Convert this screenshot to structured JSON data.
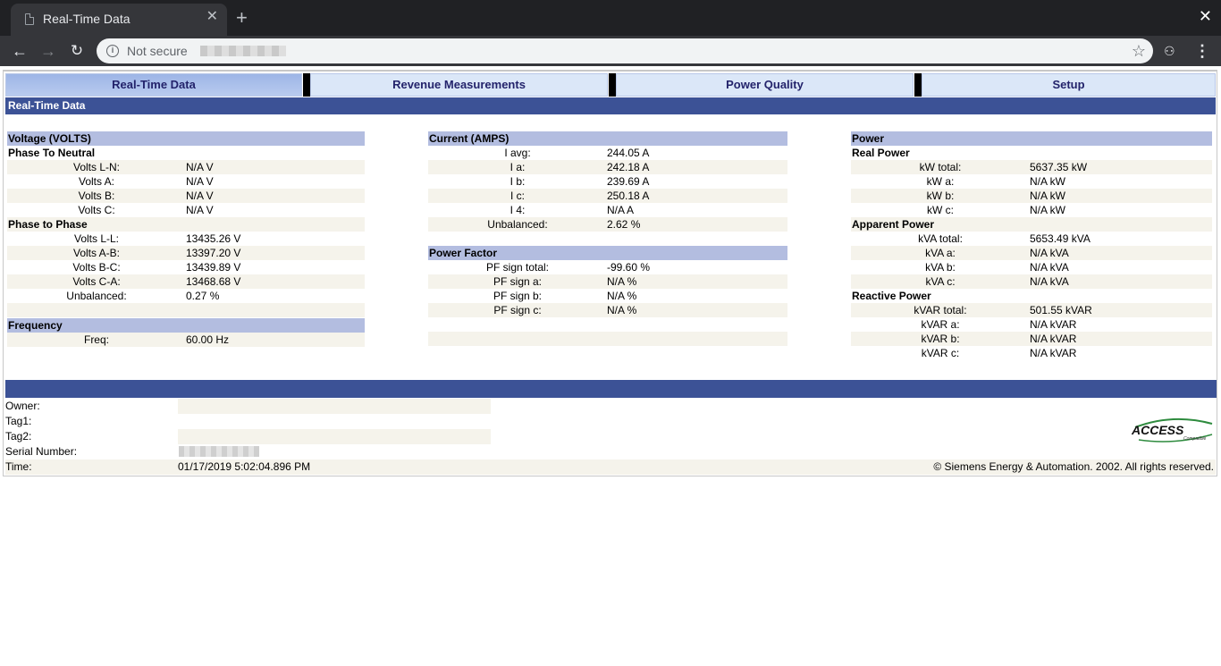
{
  "browser": {
    "tab_title": "Real-Time Data",
    "tab_close": "✕",
    "new_tab": "+",
    "window_close": "✕",
    "security_label": "Not secure",
    "back": "←",
    "forward": "→",
    "reload": "↻",
    "bookmark": "☆",
    "extension": "⚇",
    "menu": "⋮"
  },
  "nav": {
    "tabs": [
      {
        "label": "Real-Time Data",
        "active": true
      },
      {
        "label": "Revenue Measurements",
        "active": false
      },
      {
        "label": "Power Quality",
        "active": false
      },
      {
        "label": "Setup",
        "active": false
      }
    ]
  },
  "section_title": "Real-Time Data",
  "voltage": {
    "title": "Voltage (VOLTS)",
    "phase_neutral_title": "Phase To Neutral",
    "phase_neutral": [
      {
        "label": "Volts L-N:",
        "value": "N/A V"
      },
      {
        "label": "Volts A:",
        "value": "N/A V"
      },
      {
        "label": "Volts B:",
        "value": "N/A V"
      },
      {
        "label": "Volts C:",
        "value": "N/A V"
      }
    ],
    "phase_phase_title": "Phase to Phase",
    "phase_phase": [
      {
        "label": "Volts L-L:",
        "value": "13435.26 V"
      },
      {
        "label": "Volts A-B:",
        "value": "13397.20 V"
      },
      {
        "label": "Volts B-C:",
        "value": "13439.89 V"
      },
      {
        "label": "Volts C-A:",
        "value": "13468.68 V"
      },
      {
        "label": "Unbalanced:",
        "value": "0.27 %"
      }
    ]
  },
  "frequency": {
    "title": "Frequency",
    "rows": [
      {
        "label": "Freq:",
        "value": "60.00 Hz"
      }
    ]
  },
  "current": {
    "title": "Current (AMPS)",
    "rows": [
      {
        "label": "I avg:",
        "value": "244.05 A"
      },
      {
        "label": "I a:",
        "value": "242.18 A"
      },
      {
        "label": "I b:",
        "value": "239.69 A"
      },
      {
        "label": "I c:",
        "value": "250.18 A"
      },
      {
        "label": "I 4:",
        "value": "N/A A"
      },
      {
        "label": "Unbalanced:",
        "value": "2.62 %"
      }
    ]
  },
  "power_factor": {
    "title": "Power Factor",
    "rows": [
      {
        "label": "PF sign total:",
        "value": "-99.60 %"
      },
      {
        "label": "PF sign a:",
        "value": "N/A %"
      },
      {
        "label": "PF sign b:",
        "value": "N/A %"
      },
      {
        "label": "PF sign c:",
        "value": "N/A %"
      }
    ]
  },
  "power": {
    "title": "Power",
    "real_title": "Real Power",
    "real": [
      {
        "label": "kW total:",
        "value": "5637.35 kW"
      },
      {
        "label": "kW a:",
        "value": "N/A kW"
      },
      {
        "label": "kW b:",
        "value": "N/A kW"
      },
      {
        "label": "kW c:",
        "value": "N/A kW"
      }
    ],
    "apparent_title": "Apparent Power",
    "apparent": [
      {
        "label": "kVA total:",
        "value": "5653.49 kVA"
      },
      {
        "label": "kVA a:",
        "value": "N/A kVA"
      },
      {
        "label": "kVA b:",
        "value": "N/A kVA"
      },
      {
        "label": "kVA c:",
        "value": "N/A kVA"
      }
    ],
    "reactive_title": "Reactive Power",
    "reactive": [
      {
        "label": "kVAR total:",
        "value": "501.55 kVAR"
      },
      {
        "label": "kVAR a:",
        "value": "N/A kVAR"
      },
      {
        "label": "kVAR b:",
        "value": "N/A kVAR"
      },
      {
        "label": "kVAR c:",
        "value": "N/A kVAR"
      }
    ]
  },
  "footer": {
    "owner_label": "Owner:",
    "owner_value": "",
    "tag1_label": "Tag1:",
    "tag1_value": "",
    "tag2_label": "Tag2:",
    "tag2_value": "",
    "serial_label": "Serial Number:",
    "time_label": "Time:",
    "time_value": "01/17/2019 5:02:04.896 PM",
    "copyright": "© Siemens Energy & Automation. 2002. All rights reserved.",
    "logo_text": "ACCESS",
    "logo_subtext": "Compatible"
  },
  "colors": {
    "section_bar": "#3c5296",
    "group_header": "#b3bde0",
    "row_alt": "#f5f3eb",
    "tab_active": "#9db5e6",
    "tab_inactive": "#dbe7f8",
    "tab_text": "#23236b"
  }
}
